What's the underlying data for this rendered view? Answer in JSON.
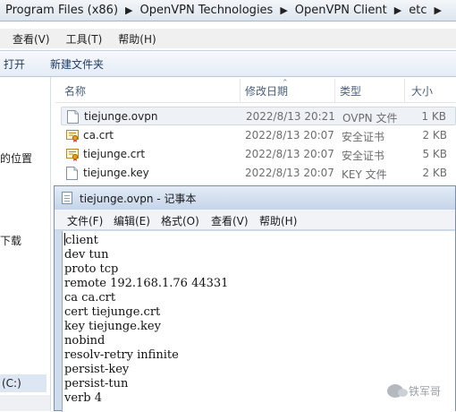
{
  "explorer": {
    "breadcrumb": [
      "Program Files (x86)",
      "OpenVPN Technologies",
      "OpenVPN Client",
      "etc"
    ],
    "menu": [
      "查看(V)",
      "工具(T)",
      "帮助(H)"
    ],
    "toolbar": {
      "open": "打开",
      "new_folder": "新建文件夹"
    },
    "sidebar": {
      "locations": "的位置",
      "downloads": "下载",
      "drive": "(C:)"
    },
    "columns": {
      "name": "名称",
      "modified": "修改日期",
      "type": "类型",
      "size": "大小"
    },
    "files": [
      {
        "name": "tiejunge.ovpn",
        "modified": "2022/8/13 20:21",
        "type": "OVPN 文件",
        "size": "1 KB",
        "icon": "document-icon"
      },
      {
        "name": "ca.crt",
        "modified": "2022/8/13 20:07",
        "type": "安全证书",
        "size": "2 KB",
        "icon": "certificate-icon"
      },
      {
        "name": "tiejunge.crt",
        "modified": "2022/8/13 20:07",
        "type": "安全证书",
        "size": "5 KB",
        "icon": "certificate-icon"
      },
      {
        "name": "tiejunge.key",
        "modified": "2022/8/13 20:07",
        "type": "KEY 文件",
        "size": "2 KB",
        "icon": "document-icon"
      }
    ]
  },
  "notepad": {
    "title": "tiejunge.ovpn - 记事本",
    "menu": {
      "file": "文件(F)",
      "edit": "编辑(E)",
      "format": "格式(O)",
      "view": "查看(V)",
      "help": "帮助(H)"
    },
    "lines": [
      "client",
      "dev tun",
      "proto tcp",
      "remote 192.168.1.76 44331",
      "ca ca.crt",
      "cert tiejunge.crt",
      "key tiejunge.key",
      "nobind",
      "resolv-retry infinite",
      "persist-key",
      "persist-tun",
      "verb 4"
    ]
  },
  "watermark": {
    "text": "铁军哥"
  },
  "colors": {
    "selection": "#eef1f5",
    "titlebar": "#c4d4e8"
  }
}
